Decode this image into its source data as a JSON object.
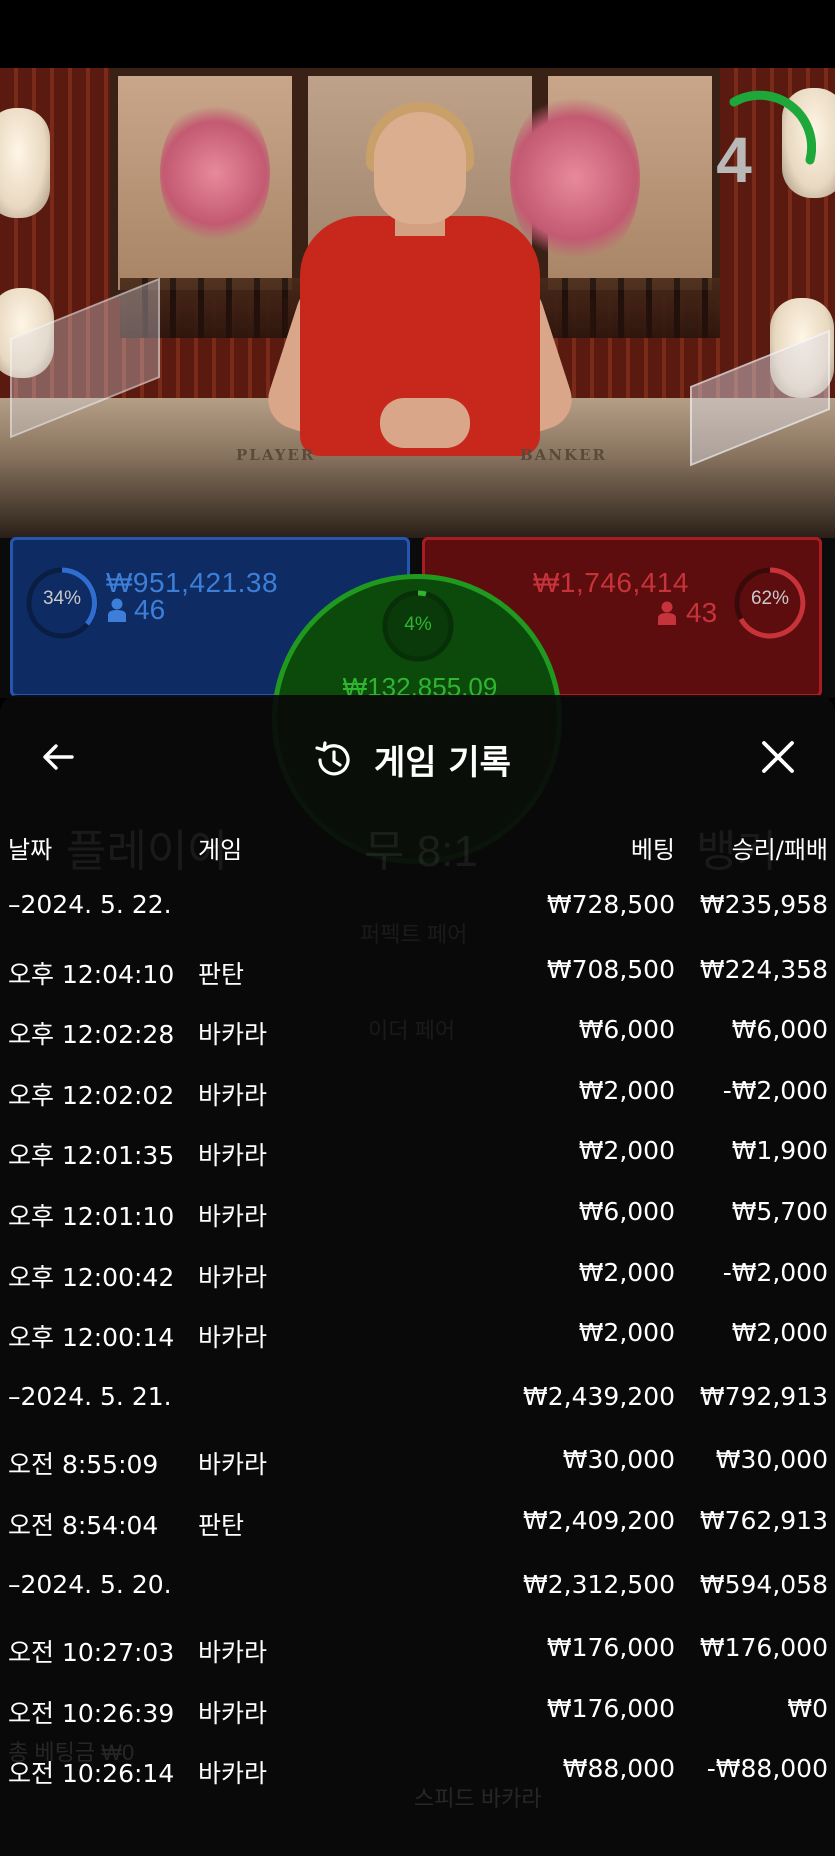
{
  "timer": {
    "count": "4"
  },
  "table_labels": {
    "player": "PLAYER",
    "banker": "BANKER"
  },
  "bets": {
    "player": {
      "percent": "34%",
      "amount": "₩951,421.38",
      "players": "46",
      "color": "#2557b0"
    },
    "banker": {
      "percent": "62%",
      "amount": "₩1,746,414",
      "players": "43",
      "color": "#a81d22"
    },
    "tie": {
      "percent": "4%",
      "amount": "₩132,855.09",
      "color": "#1f9a1f"
    }
  },
  "background_ghost": {
    "player_label": "플레이어",
    "tie_label": "무 8:1",
    "banker_label": "뱅커",
    "pair_label": "퍼펙트 페어",
    "either_pair": "이더 페어",
    "total_bet": "총 베팅금 ₩0",
    "game_name": "스피드 바카라"
  },
  "history": {
    "title": "게임 기록",
    "columns": {
      "date": "날짜",
      "game": "게임",
      "bet": "베팅",
      "result": "승리/패배"
    },
    "rows": [
      {
        "type": "date",
        "date": "–2024. 5. 22.",
        "bet": "₩728,500",
        "result": "₩235,958"
      },
      {
        "type": "entry",
        "date": "오후 12:04:10",
        "game": "판탄",
        "bet": "₩708,500",
        "result": "₩224,358"
      },
      {
        "type": "entry",
        "date": "오후 12:02:28",
        "game": "바카라",
        "bet": "₩6,000",
        "result": "₩6,000"
      },
      {
        "type": "entry",
        "date": "오후 12:02:02",
        "game": "바카라",
        "bet": "₩2,000",
        "result": "-₩2,000"
      },
      {
        "type": "entry",
        "date": "오후 12:01:35",
        "game": "바카라",
        "bet": "₩2,000",
        "result": "₩1,900"
      },
      {
        "type": "entry",
        "date": "오후 12:01:10",
        "game": "바카라",
        "bet": "₩6,000",
        "result": "₩5,700"
      },
      {
        "type": "entry",
        "date": "오후 12:00:42",
        "game": "바카라",
        "bet": "₩2,000",
        "result": "-₩2,000"
      },
      {
        "type": "entry",
        "date": "오후 12:00:14",
        "game": "바카라",
        "bet": "₩2,000",
        "result": "₩2,000"
      },
      {
        "type": "date",
        "date": "–2024. 5. 21.",
        "bet": "₩2,439,200",
        "result": "₩792,913"
      },
      {
        "type": "entry",
        "date": "오전 8:55:09",
        "game": "바카라",
        "bet": "₩30,000",
        "result": "₩30,000"
      },
      {
        "type": "entry",
        "date": "오전 8:54:04",
        "game": "판탄",
        "bet": "₩2,409,200",
        "result": "₩762,913"
      },
      {
        "type": "date",
        "date": "–2024. 5. 20.",
        "bet": "₩2,312,500",
        "result": "₩594,058"
      },
      {
        "type": "entry",
        "date": "오전 10:27:03",
        "game": "바카라",
        "bet": "₩176,000",
        "result": "₩176,000"
      },
      {
        "type": "entry",
        "date": "오전 10:26:39",
        "game": "바카라",
        "bet": "₩176,000",
        "result": "₩0"
      },
      {
        "type": "entry",
        "date": "오전 10:26:14",
        "game": "바카라",
        "bet": "₩88,000",
        "result": "-₩88,000"
      }
    ]
  }
}
